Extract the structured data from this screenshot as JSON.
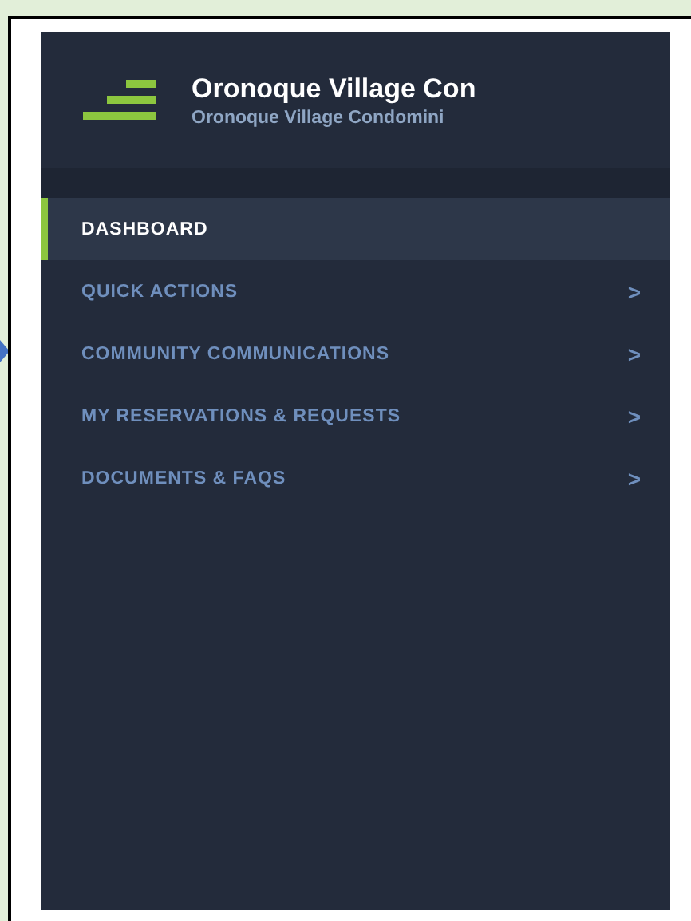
{
  "header": {
    "title": "Oronoque Village Con",
    "subtitle": "Oronoque Village Condomini"
  },
  "menu": [
    {
      "label": "DASHBOARD",
      "selected": true
    },
    {
      "label": "QUICK ACTIONS",
      "selected": false,
      "chevron": ">"
    },
    {
      "label": "COMMUNITY COMMUNICATIONS",
      "selected": false,
      "chevron": ">"
    },
    {
      "label": "MY RESERVATIONS & REQUESTS",
      "selected": false,
      "chevron": ">"
    },
    {
      "label": "DOCUMENTS & FAQS",
      "selected": false,
      "chevron": ">"
    }
  ]
}
